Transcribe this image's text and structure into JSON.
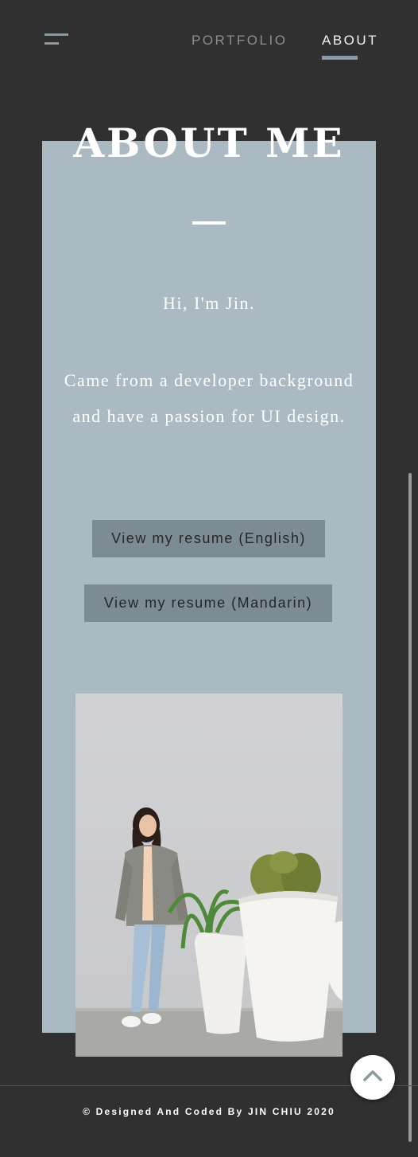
{
  "header": {
    "menu_icon": "hamburger-menu-icon",
    "nav": [
      {
        "label": "PORTFOLIO",
        "active": false
      },
      {
        "label": "ABOUT",
        "active": true
      }
    ],
    "accent_color": "#8a9aa3"
  },
  "about": {
    "title": "ABOUT ME",
    "greeting": "Hi, I'm Jin.",
    "description": "Came from a developer background and have a passion for UI design.",
    "buttons": {
      "resume_english": "View my resume (English)",
      "resume_mandarin": "View my resume (Mandarin)"
    },
    "card_color": "#abbac2",
    "button_color": "#7d8c94"
  },
  "photo": {
    "subject": "woman-with-cactus-plants-photo"
  },
  "footer": {
    "copyright": "© Designed And Coded By JIN CHIU 2020",
    "back_to_top_icon": "chevron-up-icon"
  },
  "colors": {
    "background": "#303030",
    "text": "#ffffff"
  }
}
